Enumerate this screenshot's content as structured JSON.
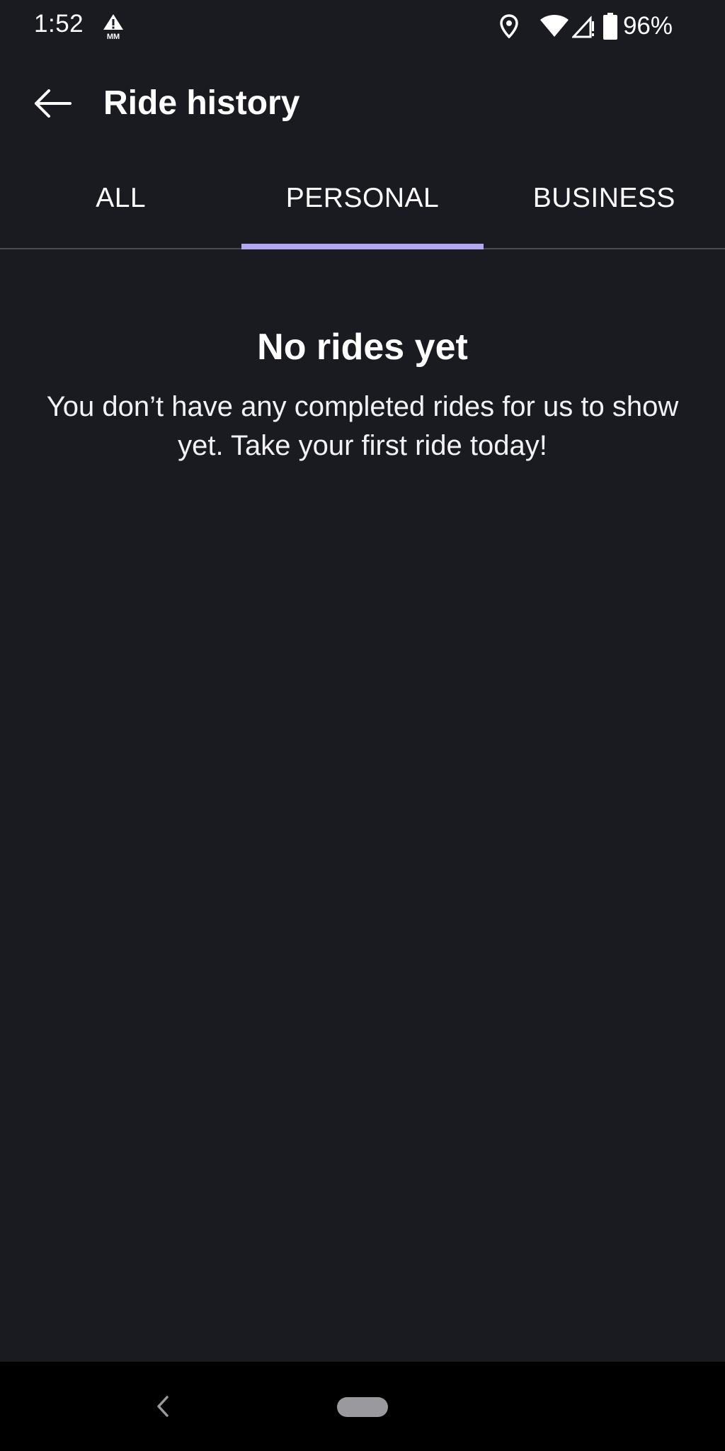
{
  "status_bar": {
    "time": "1:52",
    "battery_percent": "96%",
    "icons": [
      "alert-icon",
      "location-icon",
      "wifi-icon",
      "cell-signal-icon",
      "battery-icon"
    ]
  },
  "header": {
    "title": "Ride history",
    "back_icon": "arrow-left-icon"
  },
  "tabs": [
    {
      "label": "ALL",
      "selected": false
    },
    {
      "label": "PERSONAL",
      "selected": true
    },
    {
      "label": "BUSINESS",
      "selected": false
    }
  ],
  "empty_state": {
    "title": "No rides yet",
    "message": "You don’t have any completed rides for us to show yet. Take your first ride today!"
  },
  "colors": {
    "background": "#1a1a21",
    "tab_indicator": "#b3a7f4",
    "nav_bar": "#000000"
  }
}
